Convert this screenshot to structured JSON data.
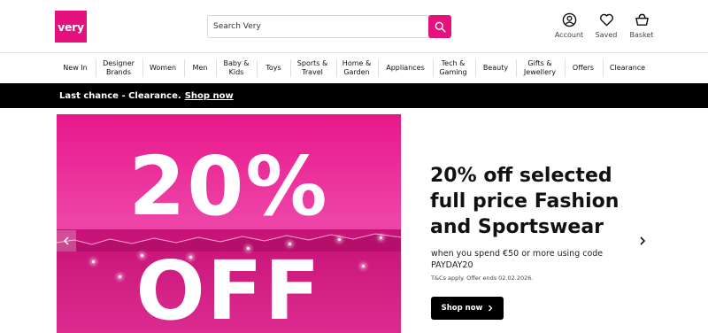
{
  "header": {
    "logo_text": "very",
    "search": {
      "placeholder": "Search Very"
    },
    "icons": [
      {
        "name": "account-icon",
        "label": "Account"
      },
      {
        "name": "heart-icon",
        "label": "Saved"
      },
      {
        "name": "basket-icon",
        "label": "Basket"
      }
    ]
  },
  "nav": {
    "items": [
      {
        "label": "New In"
      },
      {
        "label": "Designer\nBrands"
      },
      {
        "label": "Women"
      },
      {
        "label": "Men"
      },
      {
        "label": "Baby &\nKids"
      },
      {
        "label": "Toys"
      },
      {
        "label": "Sports &\nTravel"
      },
      {
        "label": "Home &\nGarden"
      },
      {
        "label": "Appliances"
      },
      {
        "label": "Tech &\nGaming"
      },
      {
        "label": "Beauty"
      },
      {
        "label": "Gifts &\nJewellery"
      },
      {
        "label": "Offers"
      },
      {
        "label": "Clearance"
      }
    ]
  },
  "promo": {
    "text": "Last chance - Clearance.",
    "link": "Shop now"
  },
  "hero": {
    "image_line1": "20%",
    "image_line2": "OFF",
    "title": "20% off selected full price Fashion and Sportswear",
    "subtitle": "when you spend €50 or more using code PAYDAY20",
    "terms": "T&Cs apply. Offer ends 02.02.2026.",
    "cta": "Shop now"
  },
  "colors": {
    "brand": "#e5127d",
    "promo_bar": "#000000"
  }
}
